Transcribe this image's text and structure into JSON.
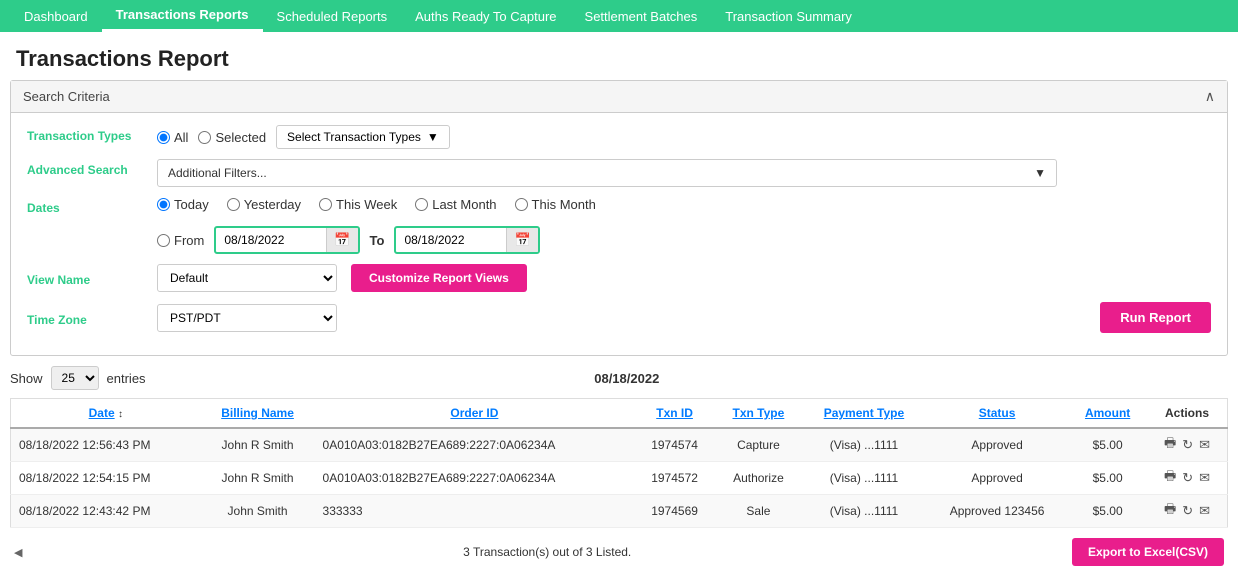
{
  "nav": {
    "items": [
      {
        "label": "Dashboard",
        "active": false
      },
      {
        "label": "Transactions Reports",
        "active": true
      },
      {
        "label": "Scheduled Reports",
        "active": false
      },
      {
        "label": "Auths Ready To Capture",
        "active": false
      },
      {
        "label": "Settlement Batches",
        "active": false
      },
      {
        "label": "Transaction Summary",
        "active": false
      }
    ]
  },
  "page": {
    "title": "Transactions Report"
  },
  "search_criteria": {
    "header": "Search Criteria",
    "transaction_types_label": "Transaction Types",
    "radio_all": "All",
    "radio_selected": "Selected",
    "select_btn": "Select Transaction Types",
    "advanced_search_label": "Advanced Search",
    "adv_placeholder": "Additional Filters...",
    "dates_label": "Dates",
    "date_today": "Today",
    "date_yesterday": "Yesterday",
    "date_this_week": "This Week",
    "date_last_month": "Last Month",
    "date_this_month": "This Month",
    "date_from_label": "From",
    "date_to_label": "To",
    "date_from_value": "08/18/2022",
    "date_to_value": "08/18/2022",
    "view_name_label": "View Name",
    "view_name_default": "Default",
    "customize_btn": "Customize Report Views",
    "time_zone_label": "Time Zone",
    "time_zone_default": "PST/PDT",
    "run_report_btn": "Run Report"
  },
  "table": {
    "show_label": "Show",
    "entries_value": "25",
    "entries_label": "entries",
    "date_display": "08/18/2022",
    "columns": [
      "Date",
      "Billing Name",
      "Order ID",
      "Txn ID",
      "Txn Type",
      "Payment Type",
      "Status",
      "Amount",
      "Actions"
    ],
    "rows": [
      {
        "date": "08/18/2022 12:56:43 PM",
        "billing_name": "John R Smith",
        "order_id": "0A010A03:0182B27EA689:2227:0A06234A",
        "txn_id": "1974574",
        "txn_type": "Capture",
        "payment_type": "(Visa) ...1111",
        "status": "Approved",
        "amount": "$5.00"
      },
      {
        "date": "08/18/2022 12:54:15 PM",
        "billing_name": "John R Smith",
        "order_id": "0A010A03:0182B27EA689:2227:0A06234A",
        "txn_id": "1974572",
        "txn_type": "Authorize",
        "payment_type": "(Visa) ...1111",
        "status": "Approved",
        "amount": "$5.00"
      },
      {
        "date": "08/18/2022 12:43:42 PM",
        "billing_name": "John Smith",
        "order_id": "333333",
        "txn_id": "1974569",
        "txn_type": "Sale",
        "payment_type": "(Visa) ...1111",
        "status": "Approved 123456",
        "amount": "$5.00"
      }
    ],
    "summary": "3 Transaction(s) out of 3 Listed.",
    "export_btn": "Export to Excel(CSV)"
  }
}
